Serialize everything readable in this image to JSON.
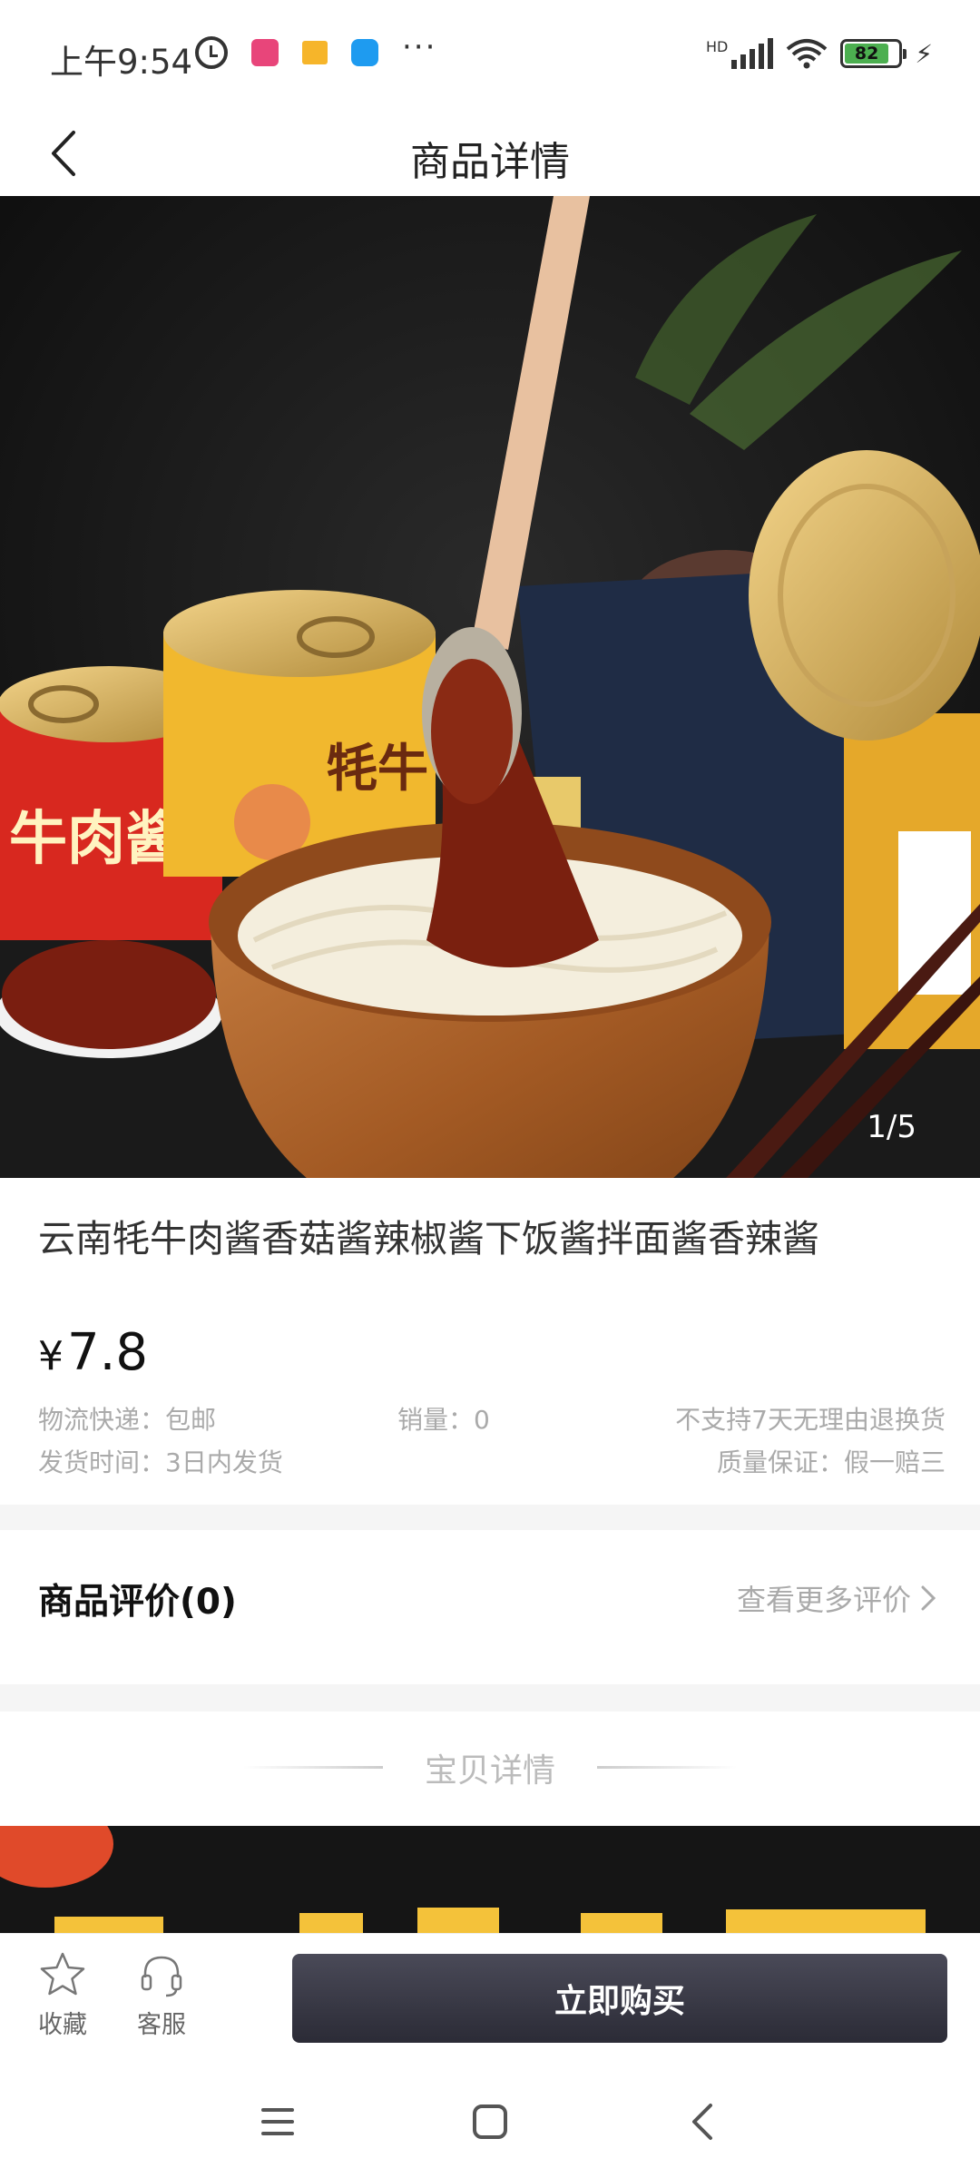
{
  "status_bar": {
    "time": "上午9:54",
    "battery": "82",
    "network": "HD",
    "more": "···"
  },
  "header": {
    "title": "商品详情"
  },
  "gallery": {
    "counter": "1/5"
  },
  "product": {
    "title": "云南牦牛肉酱香菇酱辣椒酱下饭酱拌面酱香辣酱",
    "currency": "¥",
    "price": "7.8",
    "shipping": "物流快递：包邮",
    "sales": "销量：0",
    "return_policy": "不支持7天无理由退换货",
    "ship_time": "发货时间：3日内发货",
    "guarantee": "质量保证：假一赔三"
  },
  "reviews": {
    "title": "商品评价(0)",
    "more": "查看更多评价"
  },
  "detail": {
    "label": "宝贝详情"
  },
  "bottom_bar": {
    "favorite": "收藏",
    "service": "客服",
    "buy": "立即购买"
  },
  "colors": {
    "buy_button": "#33333f",
    "meta_text": "#aaaaaa"
  }
}
